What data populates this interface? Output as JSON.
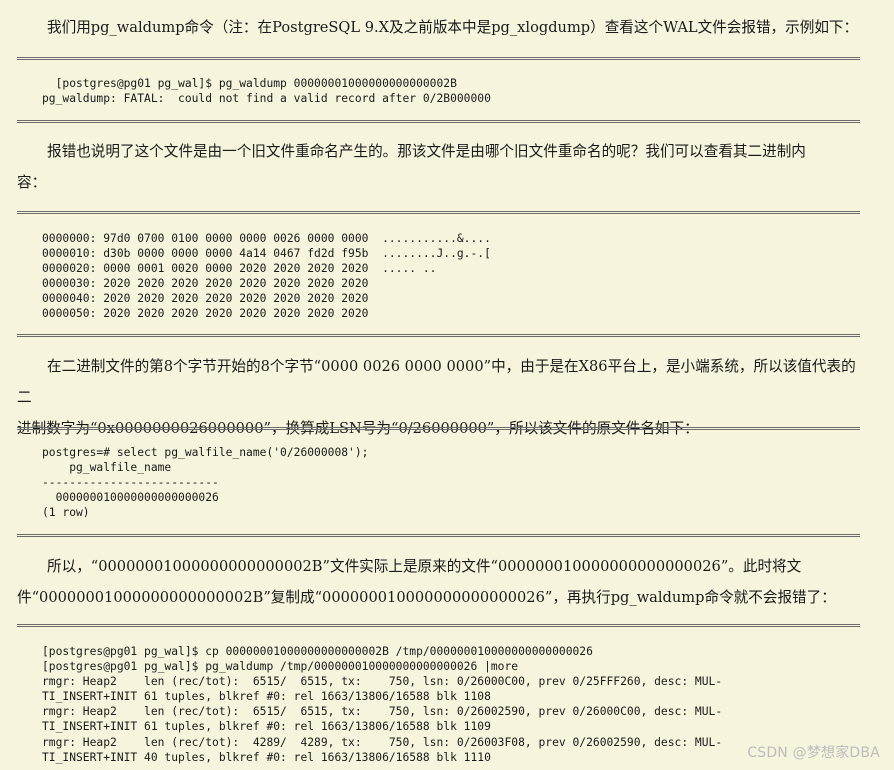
{
  "paragraphs": {
    "p1": [
      "我们用pg_waldump命令（注：在PostgreSQL 9.X及之前版本中是pg_xlogdump）查看这个WAL文件会报错，示例如下："
    ],
    "p2": [
      "报错也说明了这个文件是由一个旧文件重命名产生的。那该文件是由哪个旧文件重命名的呢？我们可以查看其二进制内",
      "容："
    ],
    "p3": [
      "在二进制文件的第8个字节开始的8个字节“0000 0026 0000 0000”中，由于是在X86平台上，是小端系统，所以该值代表的二",
      "进制数字为“0x0000000026000000”，换算成LSN号为“0/26000000”，所以该文件的原文件名如下："
    ],
    "p4": [
      "所以，“00000001000000000000002B”文件实际上是原来的文件“000000010000000000000026”。此时将文",
      "件“00000001000000000000002B”复制成“000000010000000000000026”，再执行pg_waldump命令就不会报错了："
    ]
  },
  "code": {
    "c1": "  [postgres@pg01 pg_wal]$ pg_waldump 00000001000000000000002B\npg_waldump: FATAL:  could not find a valid record after 0/2B000000",
    "c2": "0000000: 97d0 0700 0100 0000 0000 0026 0000 0000  ...........&....\n0000010: d30b 0000 0000 0000 4a14 0467 fd2d f95b  ........J..g.-.[\n0000020: 0000 0001 0020 0000 2020 2020 2020 2020  ..... ..\n0000030: 2020 2020 2020 2020 2020 2020 2020 2020\n0000040: 2020 2020 2020 2020 2020 2020 2020 2020\n0000050: 2020 2020 2020 2020 2020 2020 2020 2020",
    "c3": "postgres=# select pg_walfile_name('0/26000008');\n    pg_walfile_name\n--------------------------\n  000000010000000000000026\n(1 row)",
    "c4": "[postgres@pg01 pg_wal]$ cp 00000001000000000000002B /tmp/000000010000000000000026\n[postgres@pg01 pg_wal]$ pg_waldump /tmp/000000010000000000000026 |more\nrmgr: Heap2    len (rec/tot):  6515/  6515, tx:    750, lsn: 0/26000C00, prev 0/25FFF260, desc: MUL-\nTI_INSERT+INIT 61 tuples, blkref #0: rel 1663/13806/16588 blk 1108\nrmgr: Heap2    len (rec/tot):  6515/  6515, tx:    750, lsn: 0/26002590, prev 0/26000C00, desc: MUL-\nTI_INSERT+INIT 61 tuples, blkref #0: rel 1663/13806/16588 blk 1109\nrmgr: Heap2    len (rec/tot):  4289/  4289, tx:    750, lsn: 0/26003F08, prev 0/26002590, desc: MUL-\nTI_INSERT+INIT 40 tuples, blkref #0: rel 1663/13806/16588 blk 1110"
  },
  "watermark": "CSDN @梦想家DBA"
}
